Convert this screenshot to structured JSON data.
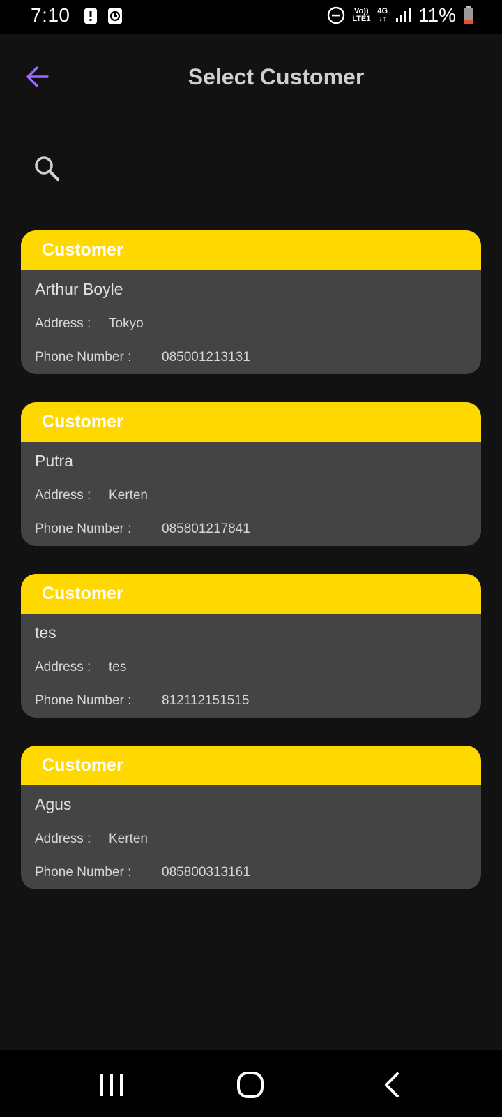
{
  "status_bar": {
    "time": "7:10",
    "volte_label_top": "Vo))",
    "volte_label_bottom": "LTE1",
    "network_label": "4G",
    "battery_percent": "11%",
    "icons": [
      "alert-icon",
      "clock-icon",
      "do-not-disturb-icon",
      "signal-icon",
      "battery-icon"
    ]
  },
  "app_bar": {
    "title": "Select Customer",
    "back_icon": "arrow-left-icon",
    "accent_color": "#9c6bff"
  },
  "search": {
    "icon": "search-icon"
  },
  "customers": [
    {
      "header": "Customer",
      "name": "Arthur Boyle",
      "address_label": "Address :",
      "address": "Tokyo",
      "phone_label": "Phone Number :",
      "phone": "085001213131"
    },
    {
      "header": "Customer",
      "name": "Putra",
      "address_label": "Address :",
      "address": "Kerten",
      "phone_label": "Phone Number :",
      "phone": "085801217841"
    },
    {
      "header": "Customer",
      "name": "tes",
      "address_label": "Address :",
      "address": "tes",
      "phone_label": "Phone Number :",
      "phone": "812112151515"
    },
    {
      "header": "Customer",
      "name": "Agus",
      "address_label": "Address :",
      "address": "Kerten",
      "phone_label": "Phone Number :",
      "phone": "085800313161"
    }
  ],
  "colors": {
    "background": "#121212",
    "card": "#444444",
    "card_header": "#ffd800"
  },
  "nav_bar": {
    "icons": [
      "recent-apps-icon",
      "home-icon",
      "back-icon"
    ]
  }
}
